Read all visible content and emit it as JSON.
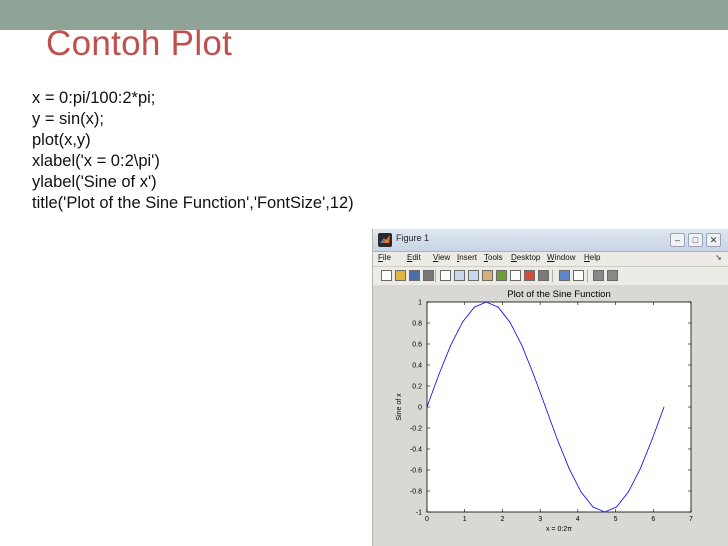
{
  "slide": {
    "title": "Contoh Plot",
    "code_lines": [
      "x = 0:pi/100:2*pi;",
      "y = sin(x);",
      "plot(x,y)",
      "xlabel('x = 0:2\\pi')",
      "ylabel('Sine of x')",
      "title('Plot of the Sine Function','FontSize',12)"
    ],
    "colors": {
      "title": "#c0504d",
      "topbar": "#8fa497",
      "line": "#0000ff"
    }
  },
  "figure_window": {
    "title": "Figure 1",
    "menus": [
      {
        "u": "F",
        "rest": "ile"
      },
      {
        "u": "E",
        "rest": "dit"
      },
      {
        "u": "V",
        "rest": "iew"
      },
      {
        "u": "I",
        "rest": "nsert"
      },
      {
        "u": "T",
        "rest": "ools"
      },
      {
        "u": "D",
        "rest": "esktop"
      },
      {
        "u": "W",
        "rest": "indow"
      },
      {
        "u": "H",
        "rest": "elp"
      }
    ],
    "toolbar_icons": [
      "new-figure-icon",
      "open-file-icon",
      "save-icon",
      "print-icon",
      "pointer-icon",
      "zoom-in-icon",
      "zoom-out-icon",
      "pan-icon",
      "rotate-icon",
      "data-cursor-icon",
      "brush-icon",
      "link-icon",
      "colorbar-icon",
      "legend-icon",
      "hide-plot-tools-icon",
      "show-plot-tools-icon"
    ]
  },
  "chart_data": {
    "type": "line",
    "title": "Plot of the Sine Function",
    "xlabel": "x = 0:2π",
    "ylabel": "Sine of x",
    "xlim": [
      0,
      7
    ],
    "ylim": [
      -1,
      1
    ],
    "xticks": [
      0,
      1,
      2,
      3,
      4,
      5,
      6,
      7
    ],
    "yticks": [
      -1,
      -0.8,
      -0.6,
      -0.4,
      -0.2,
      0,
      0.2,
      0.4,
      0.6,
      0.8,
      1
    ],
    "ytick_labels": [
      "-1",
      "-0.8",
      "-0.6",
      "-0.4",
      "-0.2",
      "0",
      "0.2",
      "0.4",
      "0.6",
      "0.8",
      "1"
    ],
    "grid": false,
    "series": [
      {
        "function": "sin(x)",
        "color": "#0000ff",
        "x": [
          0,
          0.3142,
          0.6283,
          0.9425,
          1.2566,
          1.5708,
          1.885,
          2.1991,
          2.5133,
          2.8274,
          3.1416,
          3.4558,
          3.7699,
          4.0841,
          4.3982,
          4.7124,
          5.0265,
          5.3407,
          5.6549,
          5.969,
          6.2832
        ],
        "y": [
          0,
          0.309,
          0.5878,
          0.809,
          0.9511,
          1,
          0.9511,
          0.809,
          0.5878,
          0.309,
          0,
          -0.309,
          -0.5878,
          -0.809,
          -0.9511,
          -1,
          -0.9511,
          -0.809,
          -0.5878,
          -0.309,
          0
        ]
      }
    ]
  }
}
